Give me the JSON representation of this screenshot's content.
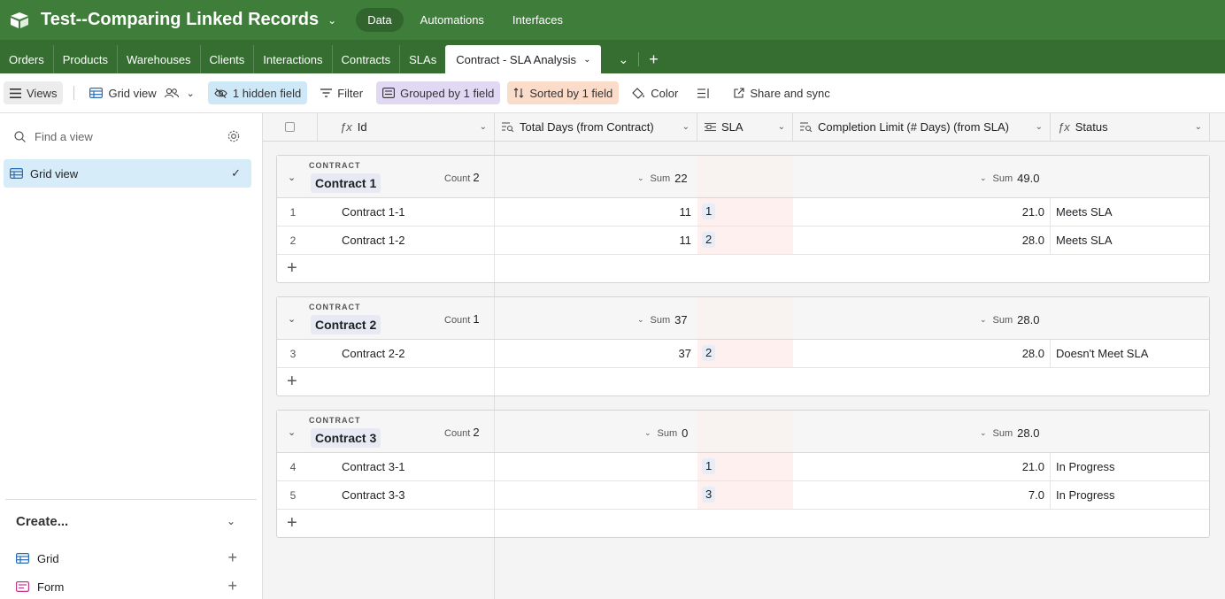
{
  "app": {
    "base_title": "Test--Comparing Linked Records",
    "nav": [
      {
        "label": "Data",
        "active": true
      },
      {
        "label": "Automations",
        "active": false
      },
      {
        "label": "Interfaces",
        "active": false
      }
    ]
  },
  "tabs": [
    "Orders",
    "Products",
    "Warehouses",
    "Clients",
    "Interactions",
    "Contracts",
    "SLAs"
  ],
  "active_tab": "Contract - SLA Analysis",
  "toolbar": {
    "views": "Views",
    "grid_view": "Grid view",
    "hidden": "1 hidden field",
    "filter": "Filter",
    "grouped": "Grouped by 1 field",
    "sorted": "Sorted by 1 field",
    "color": "Color",
    "share": "Share and sync"
  },
  "sidebar": {
    "search_placeholder": "Find a view",
    "view_item": "Grid view",
    "create_title": "Create...",
    "create_items": [
      "Grid",
      "Form"
    ]
  },
  "columns": {
    "id": "Id",
    "total": "Total Days (from Contract)",
    "sla": "SLA",
    "limit": "Completion Limit (# Days) (from SLA)",
    "status": "Status"
  },
  "group_field_label": "CONTRACT",
  "count_label": "Count",
  "sum_label": "Sum",
  "groups": [
    {
      "name": "Contract 1",
      "count": "2",
      "sum_total": "22",
      "sum_limit": "49.0",
      "rows": [
        {
          "idx": "1",
          "id": "Contract 1-1",
          "total": "11",
          "sla": "1",
          "limit": "21.0",
          "status": "Meets SLA"
        },
        {
          "idx": "2",
          "id": "Contract 1-2",
          "total": "11",
          "sla": "2",
          "limit": "28.0",
          "status": "Meets SLA"
        }
      ]
    },
    {
      "name": "Contract 2",
      "count": "1",
      "sum_total": "37",
      "sum_limit": "28.0",
      "rows": [
        {
          "idx": "3",
          "id": "Contract 2-2",
          "total": "37",
          "sla": "2",
          "limit": "28.0",
          "status": "Doesn't Meet SLA"
        }
      ]
    },
    {
      "name": "Contract 3",
      "count": "2",
      "sum_total": "0",
      "sum_limit": "28.0",
      "rows": [
        {
          "idx": "4",
          "id": "Contract 3-1",
          "total": "",
          "sla": "1",
          "limit": "21.0",
          "status": "In Progress"
        },
        {
          "idx": "5",
          "id": "Contract 3-3",
          "total": "",
          "sla": "3",
          "limit": "7.0",
          "status": "In Progress"
        }
      ]
    }
  ],
  "colors": {
    "topbar": "#3f7d3a",
    "tabbar": "#366e32",
    "hidden_chip": "#cfe8f7",
    "grouped_chip": "#e1d9f4",
    "sorted_chip": "#fbdccb",
    "selected_view": "#d6ecf9"
  }
}
